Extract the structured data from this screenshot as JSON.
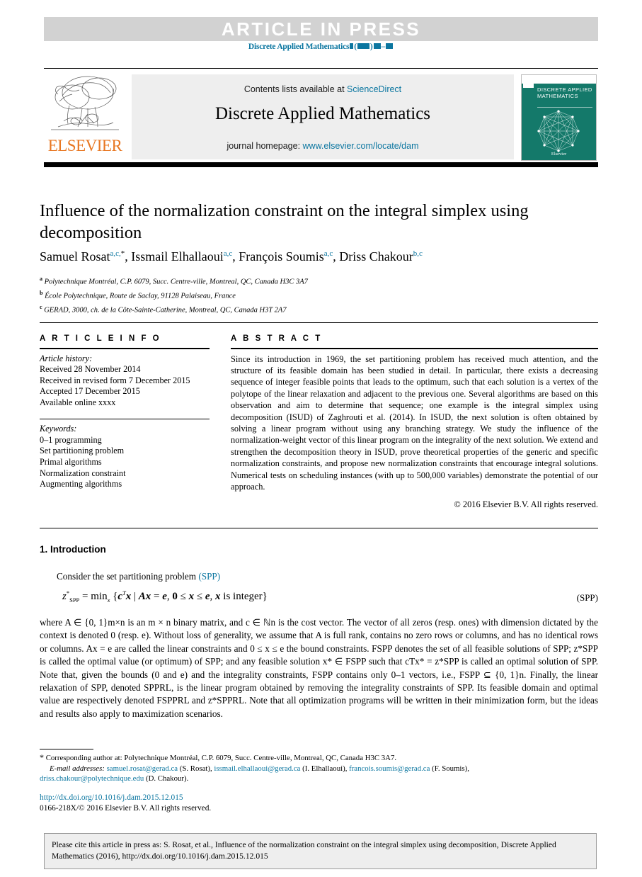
{
  "header": {
    "article_in_press": "ARTICLE  IN  PRESS",
    "journal_ref_prefix": "Discrete Applied Mathematics"
  },
  "masthead": {
    "contents_label": "Contents lists available at",
    "contents_link": "ScienceDirect",
    "journal_title": "Discrete Applied Mathematics",
    "homepage_label": "journal homepage:",
    "homepage_link": "www.elsevier.com/locate/dam",
    "publisher_wordmark": "ELSEVIER",
    "cover_title": "DISCRETE APPLIED MATHEMATICS",
    "cover_footer": "Elsevier"
  },
  "article": {
    "title": "Influence of the normalization constraint on the integral simplex using decomposition",
    "authors": [
      {
        "name": "Samuel Rosat",
        "marks": "a,c,",
        "star": "*"
      },
      {
        "name": "Issmail Elhallaoui",
        "marks": "a,c",
        "star": ""
      },
      {
        "name": "François Soumis",
        "marks": "a,c",
        "star": ""
      },
      {
        "name": "Driss Chakour",
        "marks": "b,c",
        "star": ""
      }
    ],
    "affiliations": [
      {
        "mark": "a",
        "text": "Polytechnique Montréal, C.P. 6079, Succ. Centre-ville, Montreal, QC, Canada H3C 3A7"
      },
      {
        "mark": "b",
        "text": "École Polytechnique, Route de Saclay, 91128 Palaiseau, France"
      },
      {
        "mark": "c",
        "text": "GERAD, 3000, ch. de la Côte-Sainte-Catherine, Montreal, QC, Canada H3T 2A7"
      }
    ]
  },
  "info": {
    "heading": "A R T I C L E     I N F O",
    "history_label": "Article history:",
    "history": [
      "Received 28 November 2014",
      "Received in revised form 7 December 2015",
      "Accepted 17 December 2015",
      "Available online xxxx"
    ],
    "keywords_label": "Keywords:",
    "keywords": [
      "0–1 programming",
      "Set partitioning problem",
      "Primal algorithms",
      "Normalization constraint",
      "Augmenting algorithms"
    ]
  },
  "abstract": {
    "heading": "A B S T R A C T",
    "text": "Since its introduction in 1969, the set partitioning problem has received much attention, and the structure of its feasible domain has been studied in detail. In particular, there exists a decreasing sequence of integer feasible points that leads to the optimum, such that each solution is a vertex of the polytope of the linear relaxation and adjacent to the previous one. Several algorithms are based on this observation and aim to determine that sequence; one example is the integral simplex using decomposition (ISUD) of Zaghrouti et al. (2014). In ISUD, the next solution is often obtained by solving a linear program without using any branching strategy. We study the influence of the normalization-weight vector of this linear program on the integrality of the next solution. We extend and strengthen the decomposition theory in ISUD, prove theoretical properties of the generic and specific normalization constraints, and propose new normalization constraints that encourage integral solutions. Numerical tests on scheduling instances (with up to 500,000 variables) demonstrate the potential of our approach.",
    "copyright": "© 2016 Elsevier B.V. All rights reserved."
  },
  "body": {
    "section_number": "1.",
    "section_title": "Introduction",
    "intro_lead": "Consider the set partitioning problem",
    "intro_lead_link": "(SPP)",
    "equation_tag": "(SPP)",
    "paragraph": "where A ∈ {0, 1}m×n is an m × n binary matrix, and c ∈ ℕn is the cost vector. The vector of all zeros (resp. ones) with dimension dictated by the context is denoted 0 (resp. e). Without loss of generality, we assume that A is full rank, contains no zero rows or columns, and has no identical rows or columns. Ax = e are called the linear constraints and 0 ≤ x ≤ e the bound constraints. FSPP denotes the set of all feasible solutions of SPP; z*SPP is called the optimal value (or optimum) of SPP; and any feasible solution x* ∈ FSPP such that cTx* = z*SPP is called an optimal solution of SPP. Note that, given the bounds (0 and e) and the integrality constraints, FSPP contains only 0–1 vectors, i.e., FSPP ⊆ {0, 1}n. Finally, the linear relaxation of SPP, denoted SPPRL, is the linear program obtained by removing the integrality constraints of SPP. Its feasible domain and optimal value are respectively denoted FSPPRL and z*SPPRL. Note that all optimization programs will be written in their minimization form, but the ideas and results also apply to maximization scenarios."
  },
  "footnotes": {
    "corresponding": "Corresponding author at: Polytechnique Montréal, C.P. 6079, Succ. Centre-ville, Montreal, QC, Canada H3C 3A7.",
    "email_label": "E-mail addresses:",
    "emails": [
      {
        "address": "samuel.rosat@gerad.ca",
        "who": "(S. Rosat),"
      },
      {
        "address": "issmail.elhallaoui@gerad.ca",
        "who": "(I. Elhallaoui),"
      },
      {
        "address": "francois.soumis@gerad.ca",
        "who": "(F. Soumis),"
      },
      {
        "address": "driss.chakour@polytechnique.edu",
        "who": "(D. Chakour)."
      }
    ],
    "doi": "http://dx.doi.org/10.1016/j.dam.2015.12.015",
    "issn": "0166-218X/© 2016 Elsevier B.V. All rights reserved."
  },
  "cite_box": {
    "text": "Please cite this article in press as: S. Rosat, et al., Influence of the normalization constraint on the integral simplex using decomposition, Discrete Applied Mathematics (2016), http://dx.doi.org/10.1016/j.dam.2015.12.015"
  },
  "colors": {
    "link": "#0b76a0",
    "band": "#d2d2d2",
    "elsevier_orange": "#e87722",
    "cover_green": "#14796a"
  }
}
